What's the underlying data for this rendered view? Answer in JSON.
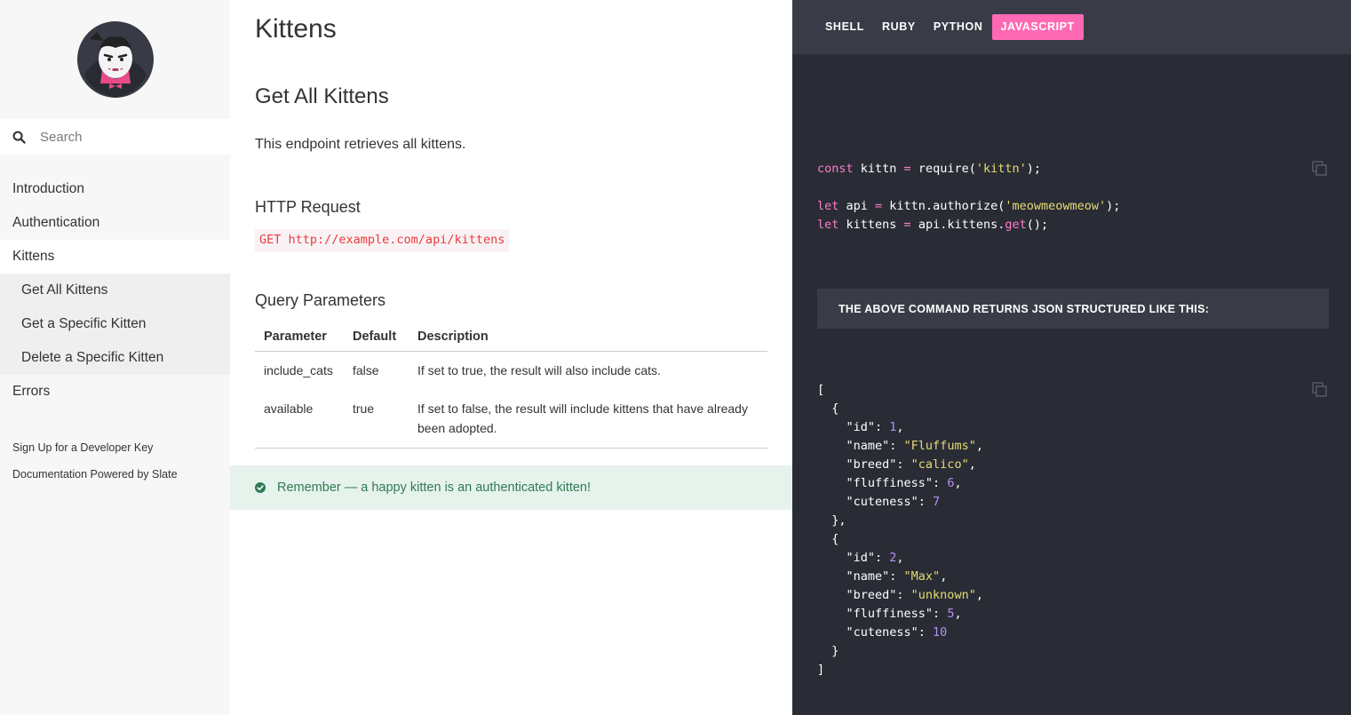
{
  "search": {
    "placeholder": "Search"
  },
  "toc": {
    "items": [
      {
        "label": "Introduction",
        "level": "top"
      },
      {
        "label": "Authentication",
        "level": "top"
      },
      {
        "label": "Kittens",
        "level": "top",
        "active": true
      },
      {
        "label": "Get All Kittens",
        "level": "sub"
      },
      {
        "label": "Get a Specific Kitten",
        "level": "sub"
      },
      {
        "label": "Delete a Specific Kitten",
        "level": "sub"
      },
      {
        "label": "Errors",
        "level": "top"
      }
    ],
    "footer": [
      "Sign Up for a Developer Key",
      "Documentation Powered by Slate"
    ]
  },
  "content": {
    "page_title": "Kittens",
    "section_title": "Get All Kittens",
    "lead": "This endpoint retrieves all kittens.",
    "http_heading": "HTTP Request",
    "http_request": "GET http://example.com/api/kittens",
    "query_heading": "Query Parameters",
    "table": {
      "headers": [
        "Parameter",
        "Default",
        "Description"
      ],
      "rows": [
        [
          "include_cats",
          "false",
          "If set to true, the result will also include cats."
        ],
        [
          "available",
          "true",
          "If set to false, the result will include kittens that have already been adopted."
        ]
      ]
    },
    "notice": "Remember — a happy kitten is an authenticated kitten!"
  },
  "langbar": {
    "tabs": [
      "SHELL",
      "RUBY",
      "PYTHON",
      "JAVASCRIPT"
    ],
    "active": "JAVASCRIPT",
    "active_color": "#ff69b4"
  },
  "code": {
    "line1": {
      "kw": "const",
      "a": " kittn ",
      "op": "=",
      "b": " require(",
      "str": "'kittn'",
      "c": ");"
    },
    "line3": {
      "kw": "let",
      "a": " api ",
      "op": "=",
      "b": " kittn.authorize(",
      "str": "'meowmeowmeow'",
      "c": ");"
    },
    "line4": {
      "kw": "let",
      "a": " kittens ",
      "op": "=",
      "b": " api.kittens.",
      "fn": "get",
      "c": "();"
    }
  },
  "returns_label": "THE ABOVE COMMAND RETURNS JSON STRUCTURED LIKE THIS:",
  "json_example": [
    {
      "id": "1",
      "name": "\"Fluffums\"",
      "breed": "\"calico\"",
      "fluffiness": "6",
      "cuteness": "7"
    },
    {
      "id": "2",
      "name": "\"Max\"",
      "breed": "\"unknown\"",
      "fluffiness": "5",
      "cuteness": "10"
    }
  ],
  "colors": {
    "sidebar_bg": "#f7f7f7",
    "dark_bg": "#292c35",
    "langbar_bg": "#393c47",
    "accent": "#ff69b4",
    "notice_bg": "#e6f2ec",
    "notice_text": "#2f7b54"
  }
}
